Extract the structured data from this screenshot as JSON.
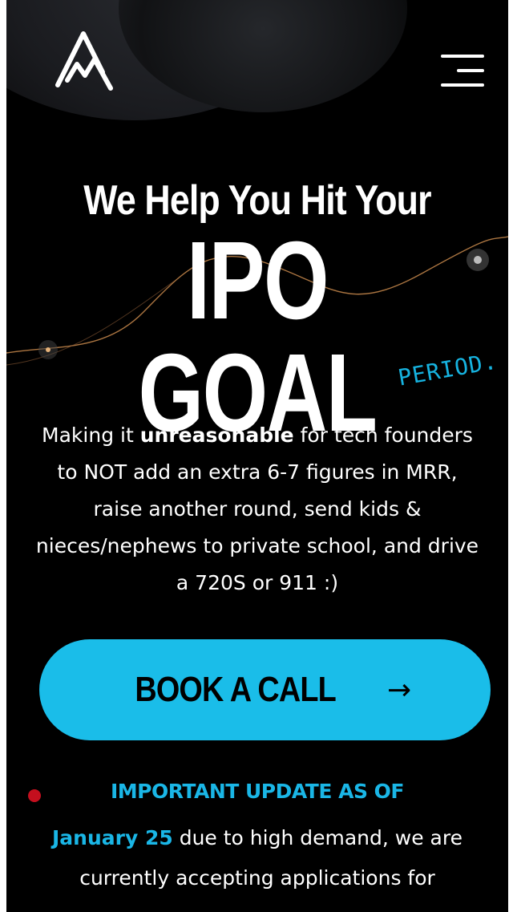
{
  "brand": {
    "logo_icon": "m-mountain-logo-icon"
  },
  "header": {
    "menu_icon": "hamburger-menu-icon"
  },
  "hero": {
    "line1": "We Help You Hit Your",
    "line2": "IPO GOAL",
    "accent": "PERIOD."
  },
  "intro": {
    "part1": "Making it ",
    "emphasis": "unreasonable",
    "part2": " for tech founders to NOT add an extra 6-7 figures in MRR, raise another round, send kids & nieces/nephews to private school, and drive a 720S or 911 :)"
  },
  "cta": {
    "label": "BOOK A CALL",
    "arrow": "→"
  },
  "update": {
    "title": "IMPORTANT UPDATE AS OF",
    "date": "January 25",
    "text": " due to high demand, we are currently accepting applications for"
  },
  "colors": {
    "accent": "#1abde9",
    "background": "#000000",
    "alert_dot": "#c40f1e"
  }
}
